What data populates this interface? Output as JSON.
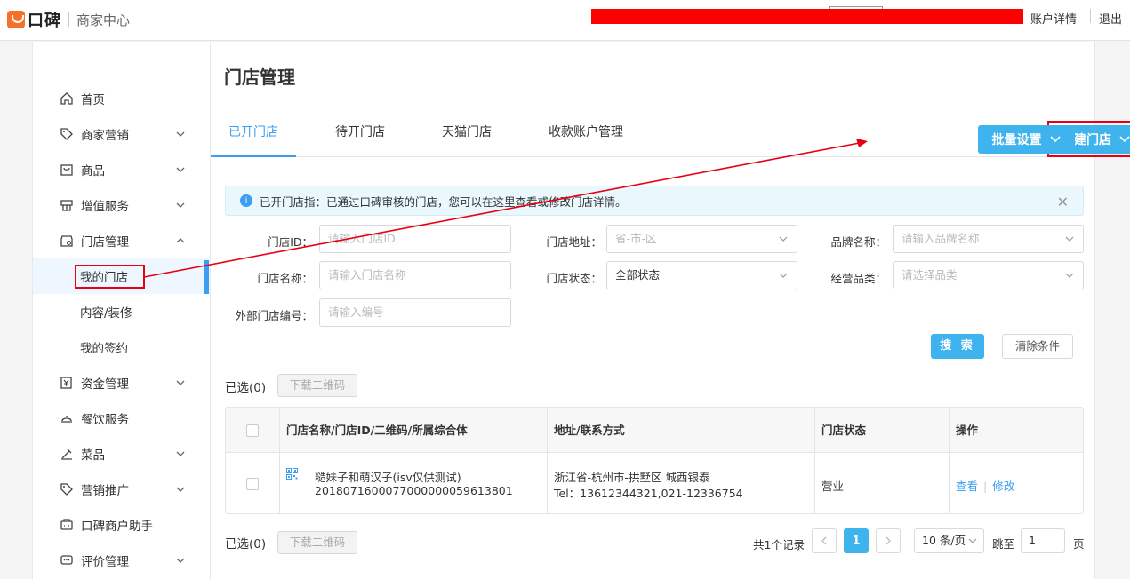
{
  "header": {
    "logo_text": "口碑",
    "logo_sub": "商家中心",
    "account_link": "账户详情",
    "logout_link": "退出"
  },
  "sidebar": {
    "items": [
      {
        "label": "首页",
        "icon": "home-icon"
      },
      {
        "label": "商家营销",
        "icon": "tag-icon"
      },
      {
        "label": "商品",
        "icon": "bag-icon"
      },
      {
        "label": "增值服务",
        "icon": "service-icon"
      },
      {
        "label": "门店管理",
        "icon": "store-icon"
      },
      {
        "label": "资金管理",
        "icon": "money-icon"
      },
      {
        "label": "餐饮服务",
        "icon": "dining-icon"
      },
      {
        "label": "菜品",
        "icon": "dish-icon"
      },
      {
        "label": "营销推广",
        "icon": "promo-tag-icon"
      },
      {
        "label": "口碑商户助手",
        "icon": "assistant-icon"
      },
      {
        "label": "评价管理",
        "icon": "comment-icon"
      }
    ],
    "store_sub": [
      {
        "label": "我的门店"
      },
      {
        "label": "内容/装修"
      },
      {
        "label": "我的签约"
      }
    ]
  },
  "main": {
    "title": "门店管理",
    "tabs": [
      "已开门店",
      "待开门店",
      "天猫门店",
      "收款账户管理"
    ],
    "create_button": "创建门店",
    "batch_button": "批量设置",
    "notice": "已开门店指：已通过口碑审核的门店，您可以在这里查看或修改门店详情。",
    "filters": {
      "store_id_label": "门店ID：",
      "store_id_placeholder": "请输入门店ID",
      "address_label": "门店地址：",
      "address_placeholder": "省-市-区",
      "brand_label": "品牌名称：",
      "brand_placeholder": "请输入品牌名称",
      "name_label": "门店名称：",
      "name_placeholder": "请输入门店名称",
      "status_label": "门店状态：",
      "status_value": "全部状态",
      "category_label": "经营品类：",
      "category_placeholder": "请选择品类",
      "external_label": "外部门店编号：",
      "external_placeholder": "请输入编号"
    },
    "search_button": "搜 索",
    "clear_button": "清除条件",
    "selected_text": "已选(0)",
    "download_qr": "下载二维码",
    "table": {
      "headers": [
        "门店名称/门店ID/二维码/所属综合体",
        "地址/联系方式",
        "门店状态",
        "操作"
      ],
      "rows": [
        {
          "name": "糙妹子和萌汉子(isv仅供测试)",
          "id": "2018071600077000000059613801",
          "address": "浙江省-杭州市-拱墅区 城西银泰",
          "phone": "Tel：13612344321,021-12336754",
          "status": "营业",
          "view": "查看",
          "sep": "|",
          "edit": "修改"
        }
      ]
    },
    "pagination": {
      "total": "共1个记录",
      "current_page": "1",
      "page_size": "10 条/页",
      "jump_label": "跳至",
      "jump_value": "1",
      "page_unit": "页"
    }
  },
  "colors": {
    "accent": "#3eb3ee",
    "link": "#3a9ef3",
    "annotation": "#e60012",
    "logo": "#f5712a"
  }
}
